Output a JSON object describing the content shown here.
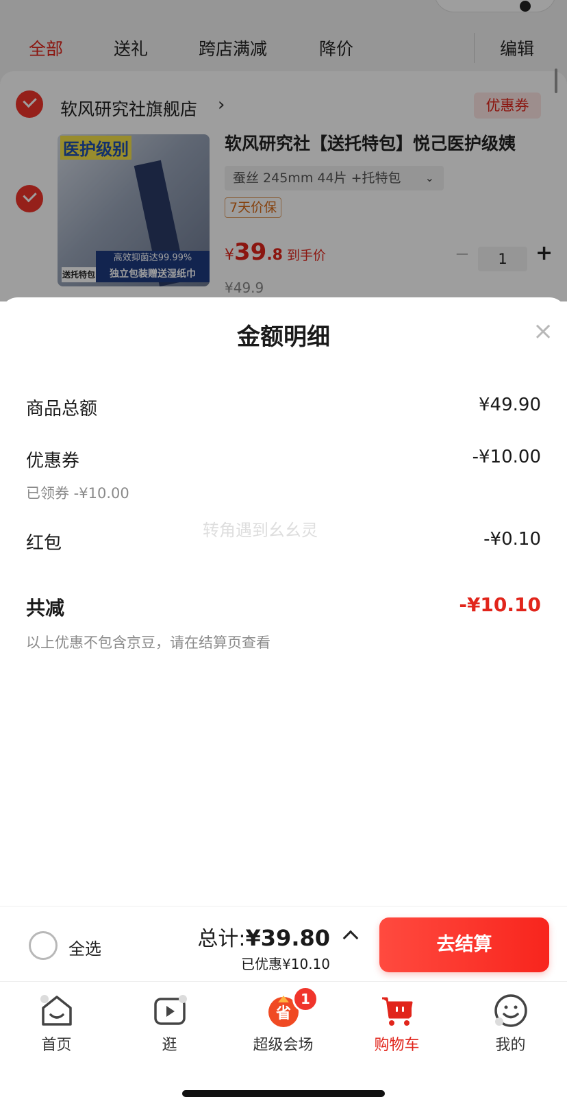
{
  "filter_tabs": {
    "all": "全部",
    "gift": "送礼",
    "cross_store": "跨店满减",
    "price_drop": "降价",
    "edit": "编辑"
  },
  "store": {
    "name": "软风研究社旗舰店",
    "chevron": "›",
    "coupon_tag": "优惠券"
  },
  "product": {
    "title": "软风研究社【送托特包】悦己医护级姨",
    "image_title": "医护级别",
    "image_badge1": "高效抑菌达99.99%",
    "image_badge2": "独立包装赠送湿纸巾",
    "image_tag": "送托特包",
    "spec": "蚕丝 245mm 44片 +托特包",
    "spec_chevron": "⌄",
    "price_guard": "7天价保",
    "price_yen": "¥",
    "price_int": "39",
    "price_dec": ".8",
    "price_label": "到手价",
    "price_old": "¥49.9",
    "qty_minus": "−",
    "quantity": "1",
    "qty_plus": "+"
  },
  "sheet": {
    "title": "金额明细",
    "close": "×",
    "watermark": "转角遇到幺幺灵",
    "rows": [
      {
        "label": "商品总额",
        "value": "¥49.90"
      },
      {
        "label": "优惠券",
        "value": "-¥10.00",
        "sub": "已领券 -¥10.00"
      },
      {
        "label": "红包",
        "value": "-¥0.10"
      }
    ],
    "total_reduce": {
      "label": "共减",
      "value": "-¥10.10",
      "note": "以上优惠不包含京豆，请在结算页查看"
    }
  },
  "checkout": {
    "select_all": "全选",
    "total_label": "总计:",
    "total_amount": "¥39.80",
    "saved": "已优惠¥10.10",
    "button": "去结算"
  },
  "tabbar": {
    "home": "首页",
    "browse": "逛",
    "super_venue": "超级会场",
    "super_venue_icon_text": "省",
    "super_venue_badge": "1",
    "cart": "购物车",
    "mine": "我的"
  },
  "colors": {
    "accent": "#e1251b",
    "checkout_button": "#f8251d",
    "overlay": "rgba(0,0,0,0.38)"
  }
}
